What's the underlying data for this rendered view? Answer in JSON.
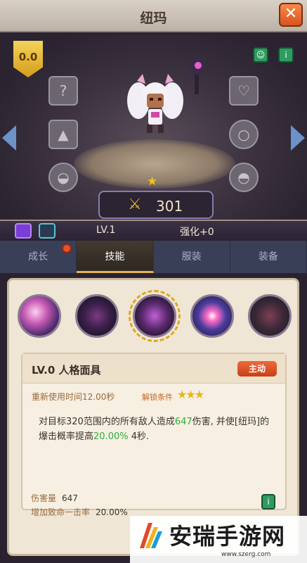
{
  "window": {
    "title": "纽玛",
    "close_glyph": "✕"
  },
  "hero": {
    "rank_value": "0.0",
    "power": "301",
    "level": "LV.1",
    "enhance": "强化+0",
    "stars": 1
  },
  "tabs": [
    {
      "label": "成长",
      "active": false,
      "has_alert": true
    },
    {
      "label": "技能",
      "active": true,
      "has_alert": false
    },
    {
      "label": "服装",
      "active": false,
      "has_alert": false
    },
    {
      "label": "装备",
      "active": false,
      "has_alert": false
    }
  ],
  "skill_detail": {
    "name": "LV.0  人格面具",
    "type_tag": "主动",
    "cooldown": "重新使用时间12.00秒",
    "unlock_label": "解锁条件",
    "unlock_stars": 3,
    "desc_parts": {
      "a": "对目标320范围内的所有敌人造成",
      "b": "647",
      "c": "伤害, 并使[纽玛]的爆击概率提高",
      "d": "20.00%",
      "e": " 4秒."
    },
    "stats": [
      {
        "label": "伤害量",
        "value": "647"
      },
      {
        "label": "增加致命一击率",
        "value": "20.00%"
      }
    ]
  },
  "watermark": {
    "text": "安瑞手游网",
    "url": "www.szerg.com"
  },
  "colors": {
    "accent": "#e2b24a",
    "highlight_green": "#2fae3c",
    "alert_red": "#e0532a"
  }
}
